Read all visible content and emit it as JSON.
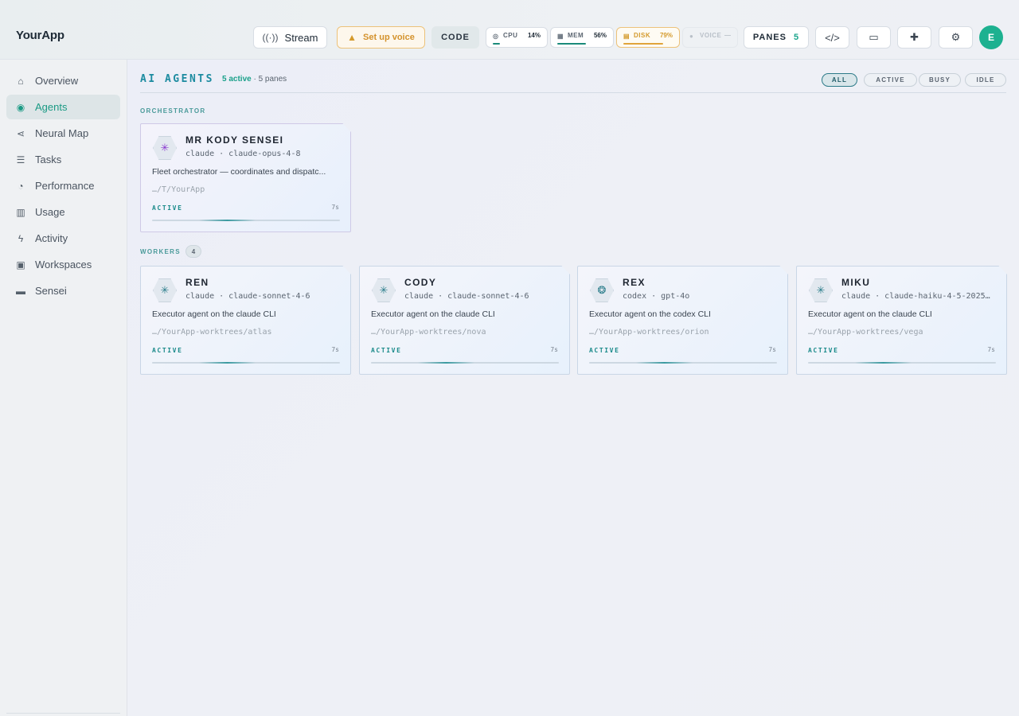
{
  "app": {
    "brand": "YourApp"
  },
  "header": {
    "stream_label": "Stream",
    "stream_icon": "antenna-icon",
    "voice_setup_label": "Set up voice",
    "voice_setup_icon": "warning-icon",
    "code_label": "CODE",
    "metrics": {
      "cpu": {
        "label": "CPU",
        "value": "14%",
        "level": 0.14
      },
      "mem": {
        "label": "MEM",
        "value": "56%",
        "level": 0.56
      },
      "disk": {
        "label": "DISK",
        "value": "79%",
        "level": 0.79,
        "status_color": "#d49a2c"
      },
      "voice": {
        "label": "VOICE",
        "value": "—"
      }
    },
    "panes_label": "PANES",
    "panes_count": "5",
    "icon_buttons": [
      "code-icon",
      "monitor-icon",
      "puzzle-icon",
      "gear-icon"
    ],
    "avatar_initial": "E",
    "accent_color": "#1db190"
  },
  "sidebar": {
    "items": [
      {
        "label": "Overview",
        "icon": "home-icon",
        "active": false
      },
      {
        "label": "Agents",
        "icon": "robot-icon",
        "active": true
      },
      {
        "label": "Neural Map",
        "icon": "share-icon",
        "active": false
      },
      {
        "label": "Tasks",
        "icon": "list-icon",
        "active": false
      },
      {
        "label": "Performance",
        "icon": "gauge-icon",
        "active": false
      },
      {
        "label": "Usage",
        "icon": "bar-chart-icon",
        "active": false
      },
      {
        "label": "Activity",
        "icon": "bolt-icon",
        "active": false
      },
      {
        "label": "Workspaces",
        "icon": "workspaces-icon",
        "active": false
      },
      {
        "label": "Sensei",
        "icon": "chat-icon",
        "active": false
      }
    ]
  },
  "main": {
    "title": "AI AGENTS",
    "active_count": "5 active",
    "panes_summary": "· 5 panes",
    "filters": [
      "ALL",
      "ACTIVE",
      "BUSY",
      "IDLE"
    ],
    "selected_filter": "ALL",
    "orchestrator_label": "ORCHESTRATOR",
    "workers_label": "WORKERS",
    "workers_count": "4",
    "orchestrator": {
      "name": "MR KODY SENSEI",
      "model": "claude · claude-opus-4-8",
      "description": "Fleet orchestrator — coordinates and dispatc...",
      "path": "…/T/YourApp",
      "status": "ACTIVE",
      "time": "7s"
    },
    "workers": [
      {
        "name": "REN",
        "model": "claude · claude-sonnet-4-6",
        "description": "Executor agent on the claude CLI",
        "path": "…/YourApp-worktrees/atlas",
        "status": "ACTIVE",
        "time": "7s",
        "icon": "claude-icon"
      },
      {
        "name": "CODY",
        "model": "claude · claude-sonnet-4-6",
        "description": "Executor agent on the claude CLI",
        "path": "…/YourApp-worktrees/nova",
        "status": "ACTIVE",
        "time": "7s",
        "icon": "claude-icon"
      },
      {
        "name": "REX",
        "model": "codex · gpt-4o",
        "description": "Executor agent on the codex CLI",
        "path": "…/YourApp-worktrees/orion",
        "status": "ACTIVE",
        "time": "7s",
        "icon": "openai-icon"
      },
      {
        "name": "MIKU",
        "model": "claude · claude-haiku-4-5-2025…",
        "description": "Executor agent on the claude CLI",
        "path": "…/YourApp-worktrees/vega",
        "status": "ACTIVE",
        "time": "7s",
        "icon": "claude-icon"
      }
    ]
  }
}
